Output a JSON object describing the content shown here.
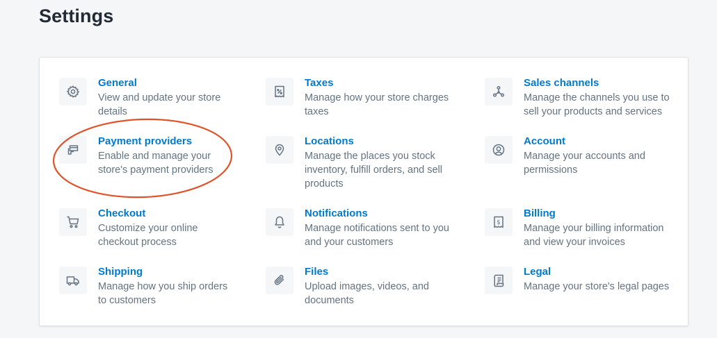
{
  "page": {
    "title": "Settings"
  },
  "colors": {
    "link": "#007ace",
    "text_subdued": "#637381",
    "annotation": "#e0522a"
  },
  "settings": {
    "items": [
      {
        "key": "general",
        "icon": "gear-icon",
        "title": "General",
        "desc": "View and update your store details"
      },
      {
        "key": "taxes",
        "icon": "tax-receipt-icon",
        "title": "Taxes",
        "desc": "Manage how your store charges taxes"
      },
      {
        "key": "sales-channels",
        "icon": "channels-icon",
        "title": "Sales channels",
        "desc": "Manage the channels you use to sell your products and services"
      },
      {
        "key": "payment-providers",
        "icon": "payment-card-icon",
        "title": "Payment providers",
        "desc": "Enable and manage your store's payment providers"
      },
      {
        "key": "locations",
        "icon": "location-pin-icon",
        "title": "Locations",
        "desc": "Manage the places you stock inventory, fulfill orders, and sell products"
      },
      {
        "key": "account",
        "icon": "user-circle-icon",
        "title": "Account",
        "desc": "Manage your accounts and permissions"
      },
      {
        "key": "checkout",
        "icon": "cart-icon",
        "title": "Checkout",
        "desc": "Customize your online checkout process"
      },
      {
        "key": "notifications",
        "icon": "bell-icon",
        "title": "Notifications",
        "desc": "Manage notifications sent to you and your customers"
      },
      {
        "key": "billing",
        "icon": "billing-icon",
        "title": "Billing",
        "desc": "Manage your billing information and view your invoices"
      },
      {
        "key": "shipping",
        "icon": "truck-icon",
        "title": "Shipping",
        "desc": "Manage how you ship orders to customers"
      },
      {
        "key": "files",
        "icon": "paperclip-icon",
        "title": "Files",
        "desc": "Upload images, videos, and documents"
      },
      {
        "key": "legal",
        "icon": "document-icon",
        "title": "Legal",
        "desc": "Manage your store's legal pages"
      }
    ]
  },
  "annotation": {
    "target": "payment-providers",
    "shape": "ellipse"
  }
}
